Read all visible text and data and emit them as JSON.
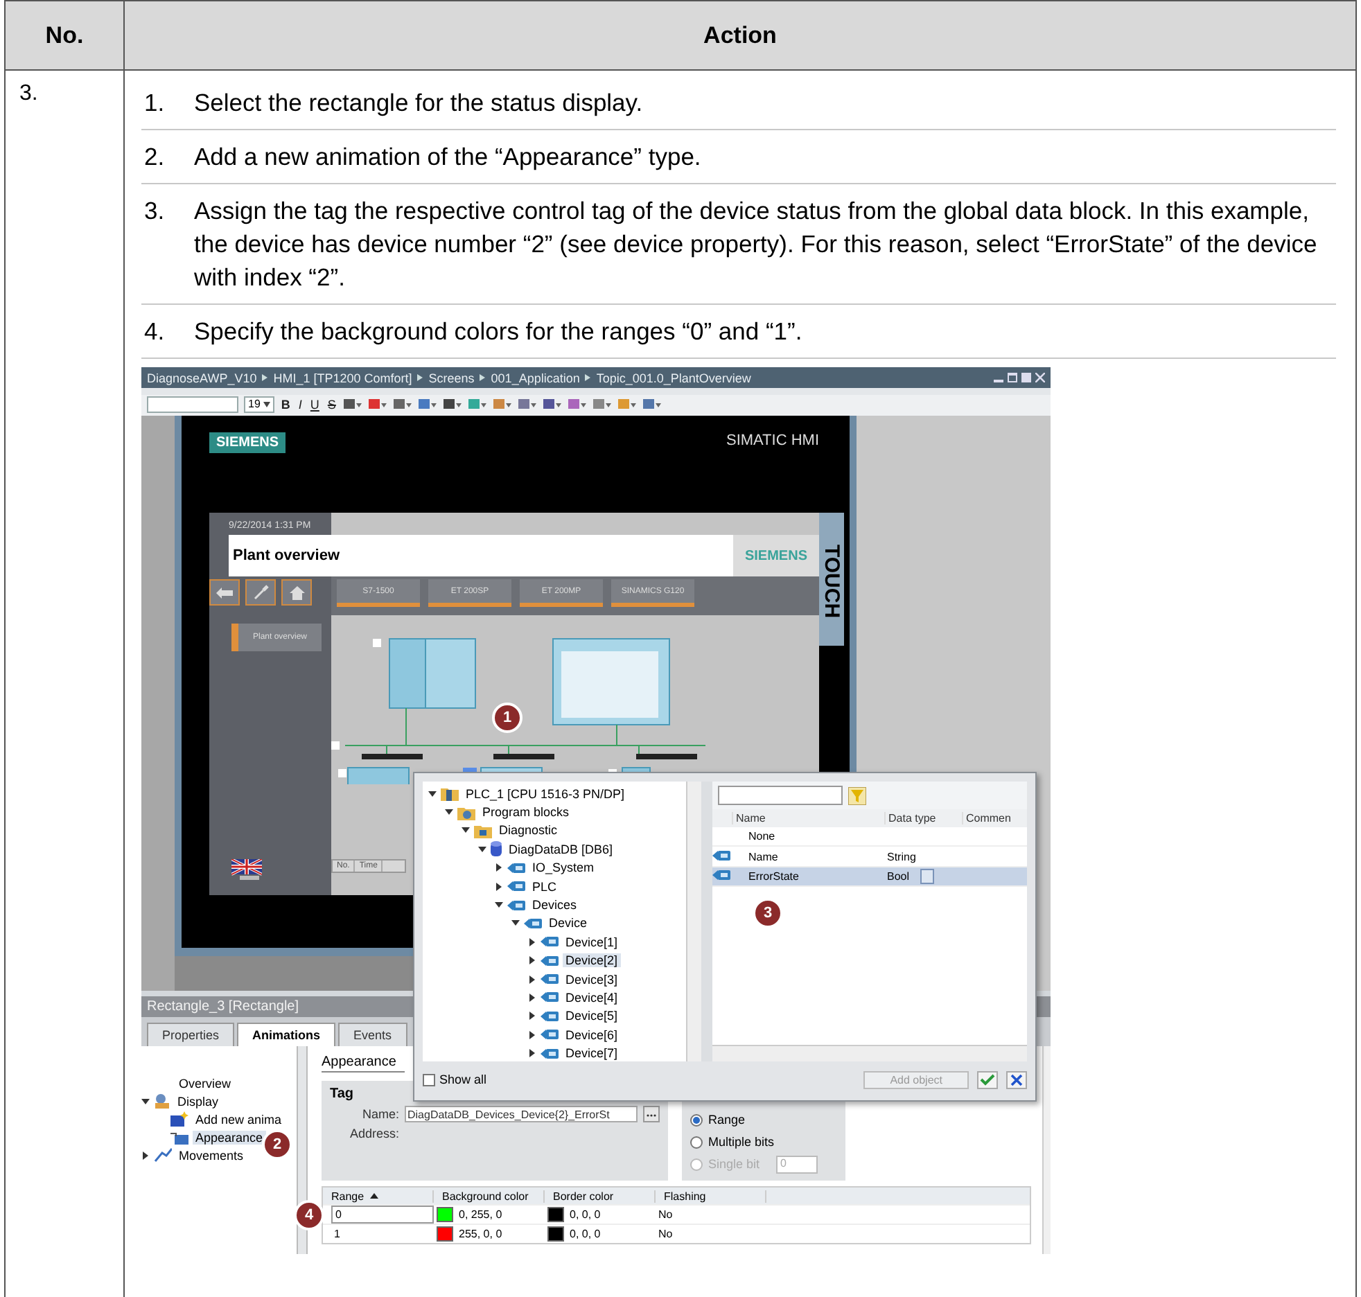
{
  "table": {
    "columns": [
      "No.",
      "Action"
    ],
    "rows": [
      {
        "number": "3.",
        "steps": [
          {
            "number": "1.",
            "text": "Select the rectangle for the status display."
          },
          {
            "number": "2.",
            "text": "Add a new animation of the “Appearance” type."
          },
          {
            "number": "3.",
            "text": "Assign the tag the respective control tag of the device status from the global data block. In this example, the device has device number “2” (see device property). For this reason, select “ErrorState” of the device with index “2”."
          },
          {
            "number": "4.",
            "text": "Specify the background colors for the ranges “0” and “1”."
          }
        ]
      }
    ]
  },
  "screenshot": {
    "breadcrumb": [
      "DiagnoseAWP_V10",
      "HMI_1 [TP1200 Comfort]",
      "Screens",
      "001_Application",
      "Topic_001.0_PlantOverview"
    ],
    "toolbar": {
      "font_size": "19",
      "format_buttons": [
        "B",
        "I",
        "U",
        "S"
      ]
    },
    "hmi": {
      "brand": "SIEMENS",
      "model": "SIMATIC HMI",
      "side_label": "TOUCH",
      "date": "9/22/2014 1:31 PM",
      "screen_title": "Plant overview",
      "header_logo": "SIEMENS",
      "tabs": [
        "S7-1500",
        "ET 200SP",
        "ET 200MP",
        "SINAMICS G120"
      ],
      "nav_button": "Plant overview",
      "alarm_columns": [
        "No.",
        "Time"
      ]
    },
    "properties": {
      "title": "Rectangle_3 [Rectangle]",
      "tabs": [
        {
          "label": "Properties",
          "selected": false
        },
        {
          "label": "Animations",
          "selected": true
        },
        {
          "label": "Events",
          "selected": false
        }
      ],
      "tree": [
        {
          "label": "Overview",
          "kind": "none",
          "selected": false
        },
        {
          "label": "Display",
          "kind": "display",
          "expanded": true,
          "selected": false,
          "children": [
            {
              "label": "Add new anima",
              "kind": "add",
              "selected": false
            },
            {
              "label": "Appearance",
              "kind": "appearance",
              "selected": true
            }
          ]
        },
        {
          "label": "Movements",
          "kind": "movement",
          "expanded": false,
          "selected": false
        }
      ],
      "section_title": "Appearance",
      "tag_group": {
        "title": "Tag",
        "name_label": "Name:",
        "name_value": "DiagDataDB_Devices_Device{2}_ErrorSt",
        "address_label": "Address:"
      },
      "type_options": [
        {
          "label": "Range",
          "selected": true,
          "disabled": false
        },
        {
          "label": "Multiple bits",
          "selected": false,
          "disabled": false
        },
        {
          "label": "Single bit",
          "selected": false,
          "disabled": true
        }
      ],
      "bit_value": "0",
      "range_columns": [
        "Range",
        "Background color",
        "Border color",
        "Flashing"
      ],
      "ranges": [
        {
          "range": "0",
          "background": "0, 255, 0",
          "border": "0, 0, 0",
          "flashing": "No",
          "selected": true
        },
        {
          "range": "1",
          "background": "255, 0, 0",
          "border": "0, 0, 0",
          "flashing": "No",
          "selected": false
        }
      ]
    },
    "dialog": {
      "tree": [
        {
          "label": "PLC_1 [CPU 1516-3 PN/DP]",
          "kind": "plc",
          "expanded": true,
          "selected": false,
          "children": [
            {
              "label": "Program blocks",
              "kind": "blocks",
              "expanded": true,
              "selected": false,
              "children": [
                {
                  "label": "Diagnostic",
                  "kind": "group",
                  "expanded": true,
                  "selected": false,
                  "children": [
                    {
                      "label": "DiagDataDB [DB6]",
                      "kind": "db",
                      "expanded": true,
                      "selected": false,
                      "children": [
                        {
                          "label": "IO_System",
                          "kind": "struct",
                          "expanded": false,
                          "selected": false
                        },
                        {
                          "label": "PLC",
                          "kind": "struct",
                          "expanded": false,
                          "selected": false
                        },
                        {
                          "label": "Devices",
                          "kind": "struct",
                          "expanded": true,
                          "selected": false,
                          "children": [
                            {
                              "label": "Device",
                              "kind": "struct",
                              "expanded": true,
                              "selected": false,
                              "children": [
                                {
                                  "label": "Device[1]",
                                  "kind": "struct",
                                  "expanded": false,
                                  "selected": false
                                },
                                {
                                  "label": "Device[2]",
                                  "kind": "struct",
                                  "expanded": false,
                                  "selected": true
                                },
                                {
                                  "label": "Device[3]",
                                  "kind": "struct",
                                  "expanded": false,
                                  "selected": false
                                },
                                {
                                  "label": "Device[4]",
                                  "kind": "struct",
                                  "expanded": false,
                                  "selected": false
                                },
                                {
                                  "label": "Device[5]",
                                  "kind": "struct",
                                  "expanded": false,
                                  "selected": false
                                },
                                {
                                  "label": "Device[6]",
                                  "kind": "struct",
                                  "expanded": false,
                                  "selected": false
                                },
                                {
                                  "label": "Device[7]",
                                  "kind": "struct",
                                  "expanded": false,
                                  "selected": false
                                }
                              ]
                            }
                          ]
                        }
                      ]
                    }
                  ]
                }
              ]
            }
          ]
        }
      ],
      "columns": [
        "Name",
        "Data type",
        "Commen"
      ],
      "rows": [
        {
          "name": "None",
          "kind": "none",
          "selected": false
        },
        {
          "name": "Name",
          "type": "String",
          "kind": "tag",
          "selected": false
        },
        {
          "name": "ErrorState",
          "type": "Bool",
          "kind": "tag",
          "selected": true
        }
      ],
      "show_all": {
        "label": "Show all",
        "checked": false
      },
      "add_object": {
        "label": "Add object",
        "disabled": true
      }
    },
    "callouts": [
      "1",
      "2",
      "3",
      "4"
    ]
  }
}
